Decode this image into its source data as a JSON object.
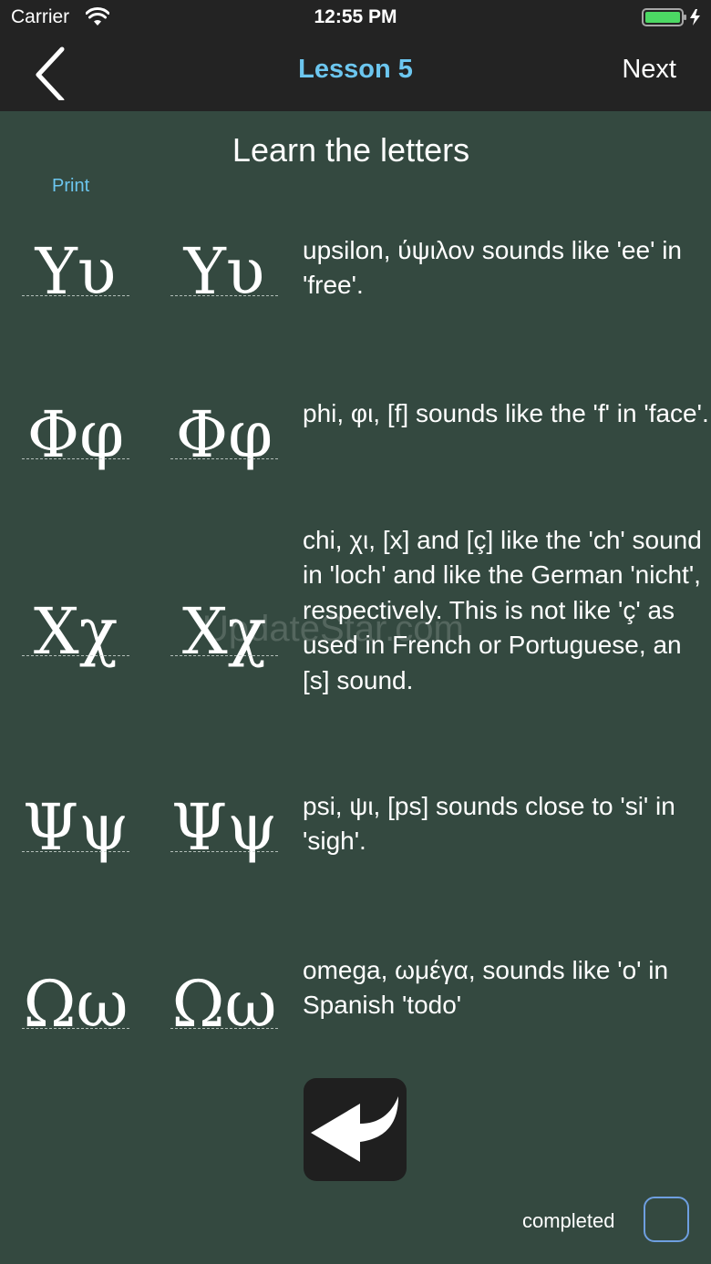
{
  "status_bar": {
    "carrier": "Carrier",
    "time": "12:55 PM"
  },
  "nav": {
    "back_icon": "chevron-left-icon",
    "title": "Lesson 5",
    "next_label": "Next"
  },
  "heading": "Learn the letters",
  "print_label": "Print",
  "letters": [
    {
      "glyph": "Υυ",
      "description": "upsilon, ύψιλον sounds like 'ee' in 'free'."
    },
    {
      "glyph": "Φφ",
      "description": "phi, φι, [f] sounds like the 'f' in 'face'."
    },
    {
      "glyph": "Χχ",
      "description": "chi, χι, [x] and [ç] like the 'ch' sound in 'loch' and like the German 'nicht', respectively. This is not like 'ç' as used in French or Portuguese, an [s] sound."
    },
    {
      "glyph": "Ψψ",
      "description": "psi, ψι, [ps] sounds close to 'si' in 'sigh'."
    },
    {
      "glyph": "Ωω",
      "description": "omega, ωμέγα, sounds like 'o' in Spanish 'todo'"
    }
  ],
  "watermark": "UpdateStar.com",
  "return_icon": "return-arrow-icon",
  "completed_label": "completed",
  "colors": {
    "background": "#344940",
    "bar": "#232323",
    "accent": "#6cc6ef",
    "checkbox_border": "#6e9fe0"
  }
}
